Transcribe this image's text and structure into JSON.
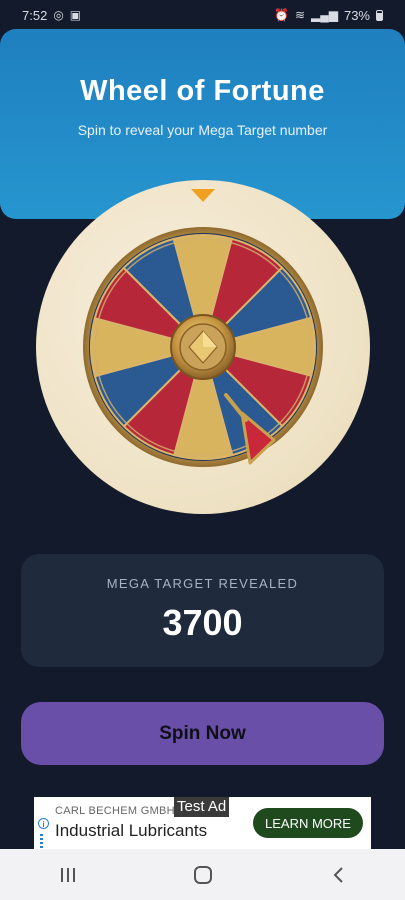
{
  "status_bar": {
    "time": "7:52",
    "battery": "73%",
    "icons": [
      "whatsapp-icon",
      "image-icon",
      "alarm-icon",
      "wifi-icon",
      "signal-icon",
      "battery-icon"
    ]
  },
  "header": {
    "title": "Wheel of Fortune",
    "subtitle": "Spin to reveal your Mega Target number"
  },
  "wheel": {
    "segment_colors": [
      "#b7273a",
      "#2b5a93",
      "#d8b45e"
    ],
    "rim_color": "#c79b4a"
  },
  "result": {
    "label": "MEGA TARGET REVEALED",
    "value": "3700"
  },
  "spin_button": {
    "label": "Spin Now",
    "color": "#6a4fa8"
  },
  "ad": {
    "company": "CARL BECHEM GMBH",
    "product": "Industrial Lubricants",
    "tag": "Test Ad",
    "cta": "LEARN MORE"
  },
  "nav": {
    "buttons": [
      "recent-apps-icon",
      "home-icon",
      "back-icon"
    ]
  }
}
